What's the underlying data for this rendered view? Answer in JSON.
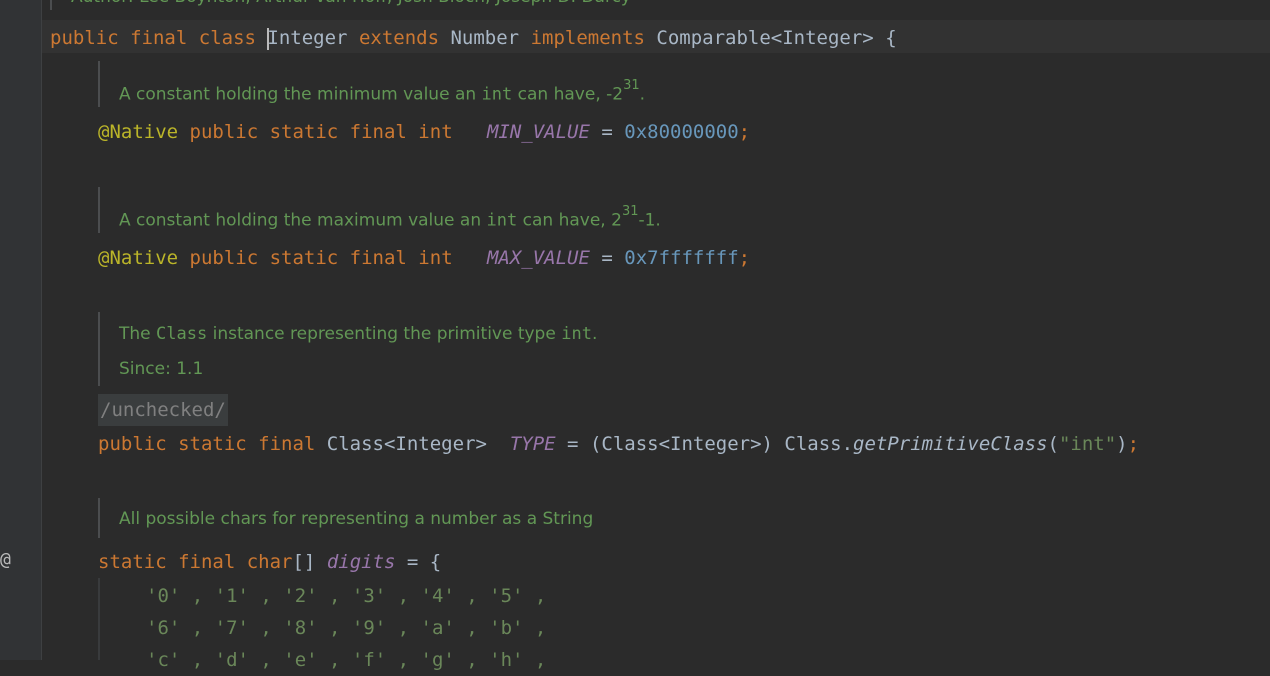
{
  "author_line": "Author: Lee Boynton, Arthur van Hoff, Josh Bloch, Joseph D. Darcy",
  "class_decl": {
    "public": "public",
    "final": "final",
    "class": "class",
    "name": "Integer",
    "extends": "extends",
    "super": "Number",
    "implements": "implements",
    "iface": "Comparable<Integer>",
    "brace": "{"
  },
  "doc_min": {
    "text": "A constant holding the minimum value an ",
    "code": "int",
    "text2": " can have, -2",
    "sup": "31",
    "end": "."
  },
  "min_decl": {
    "annotation": "@Native",
    "mods": "public static final int",
    "name": "MIN_VALUE",
    "eq": " = ",
    "value": "0x80000000",
    "semi": ";"
  },
  "doc_max": {
    "text": "A constant holding the maximum value an ",
    "code": "int",
    "text2": " can have, 2",
    "sup": "31",
    "end": "-1."
  },
  "max_decl": {
    "annotation": "@Native",
    "mods": "public static final int",
    "name": "MAX_VALUE",
    "eq": " = ",
    "value": "0x7fffffff",
    "semi": ";"
  },
  "doc_type": {
    "text1": "The ",
    "code1": "Class",
    "text2": " instance representing the primitive type ",
    "code2": "int",
    "text3": ".",
    "since": "Since: 1.1"
  },
  "unchecked": "/unchecked/",
  "type_decl": {
    "mods": "public static final",
    "type": "Class<Integer>",
    "name": "TYPE",
    "eq": " = ",
    "cast": "(Class<Integer>) Class.",
    "method": "getPrimitiveClass",
    "open": "(",
    "arg": "\"int\"",
    "close": ")",
    "semi": ";"
  },
  "doc_digits": {
    "text": "All possible chars for representing a number as a String"
  },
  "digits_decl": {
    "mods": "static final char",
    "brackets": "[]",
    "name": "digits",
    "eq": " = {"
  },
  "digits_rows": [
    "'0' , '1' , '2' , '3' , '4' , '5' ,",
    "'6' , '7' , '8' , '9' , 'a' , 'b' ,",
    "'c' , 'd' , 'e' , 'f' , 'g' , 'h' ,"
  ],
  "gutter_marker": "@",
  "colors": {
    "background": "#2b2b2b",
    "keyword": "#cc7832",
    "doc": "#629755",
    "constant": "#9876aa",
    "number": "#6897bb",
    "annotation": "#bbb529",
    "string": "#6a8759"
  }
}
